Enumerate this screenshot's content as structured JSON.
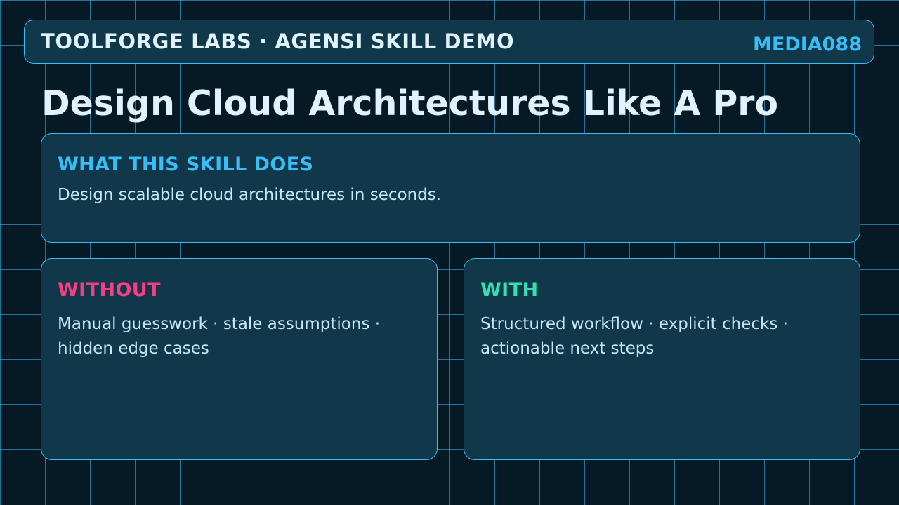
{
  "header": {
    "title": "TOOLFORGE LABS · AGENSI SKILL DEMO",
    "code": "MEDIA088"
  },
  "page_title": "Design Cloud Architectures Like A Pro",
  "what_card": {
    "heading": "WHAT THIS SKILL DOES",
    "body": "Design scalable cloud architectures in seconds."
  },
  "without_card": {
    "heading": "WITHOUT",
    "body": "Manual guesswork · stale assumptions · hidden edge cases"
  },
  "with_card": {
    "heading": "WITH",
    "body": "Structured workflow · explicit checks · actionable next steps"
  },
  "colors": {
    "background": "#061a26",
    "panel": "#10374a",
    "accent": "#38bdf8",
    "without_accent": "#f43f85",
    "with_accent": "#34e0b0",
    "text": "#e0f2fe"
  }
}
